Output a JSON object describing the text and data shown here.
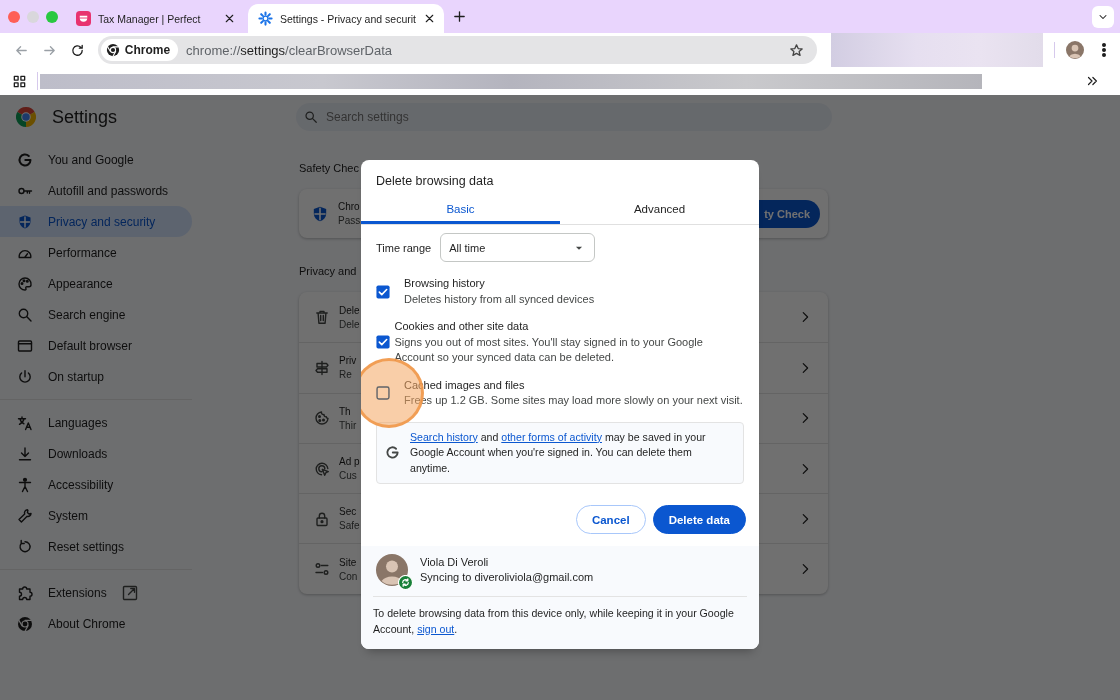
{
  "browser": {
    "tabs": [
      {
        "title": "Tax Manager | Perfect",
        "selected": false
      },
      {
        "title": "Settings - Privacy and securit",
        "selected": true
      }
    ],
    "site_chip": "Chrome",
    "url": "chrome://**settings**/clearBrowserData"
  },
  "settings": {
    "title": "Settings",
    "search": {
      "placeholder": "Search settings"
    },
    "sidebar_groups": [
      {
        "items": [
          {
            "label": "You and Google",
            "selected": false
          },
          {
            "label": "Autofill and passwords",
            "selected": false
          },
          {
            "label": "Privacy and security",
            "selected": true
          },
          {
            "label": "Performance",
            "selected": false
          },
          {
            "label": "Appearance",
            "selected": false
          },
          {
            "label": "Search engine",
            "selected": false
          },
          {
            "label": "Default browser",
            "selected": false
          },
          {
            "label": "On startup",
            "selected": false
          }
        ]
      },
      {
        "items": [
          {
            "label": "Languages",
            "selected": false
          },
          {
            "label": "Downloads",
            "selected": false
          },
          {
            "label": "Accessibility",
            "selected": false
          },
          {
            "label": "System",
            "selected": false
          },
          {
            "label": "Reset settings",
            "selected": false
          }
        ]
      },
      {
        "items": [
          {
            "label": "Extensions",
            "selected": false
          },
          {
            "label": "About Chrome",
            "selected": false
          }
        ]
      }
    ],
    "safety_check": {
      "heading": "Safety Chec",
      "card_title": "Chro",
      "card_subtitle": "Pass",
      "button": "ty Check"
    },
    "privacy": {
      "heading": "Privacy and",
      "rows": [
        {
          "title": "Dele",
          "subtitle": "Dele"
        },
        {
          "title": "Priv",
          "subtitle": "Re"
        },
        {
          "title": "Th",
          "subtitle": "Thir"
        },
        {
          "title": "Ad p",
          "subtitle": "Cus"
        },
        {
          "title": "Sec",
          "subtitle": "Safe"
        },
        {
          "title": "Site",
          "subtitle": "Con"
        }
      ]
    }
  },
  "dialog": {
    "title": "Delete browsing data",
    "tabs": [
      {
        "label": "Basic",
        "selected": true
      },
      {
        "label": "Advanced",
        "selected": false
      }
    ],
    "time_range": {
      "label": "Time range",
      "value": "All time"
    },
    "options": [
      {
        "title": "Browsing history",
        "description": "Deletes history from all synced devices",
        "checked": true,
        "highlighted": false
      },
      {
        "title": "Cookies and other site data",
        "description": "Signs you out of most sites. You'll stay signed in to your Google Account so your synced data can be deleted.",
        "checked": true,
        "highlighted": false
      },
      {
        "title": "Cached images and files",
        "description": "Frees up 1.2 GB. Some sites may load more slowly on your next visit.",
        "checked": false,
        "highlighted": true
      }
    ],
    "notice": {
      "parts": [
        {
          "kind": "link",
          "text": "Search history"
        },
        {
          "kind": "text",
          "text": " and "
        },
        {
          "kind": "link",
          "text": "other forms of activity"
        },
        {
          "kind": "text",
          "text": " may be saved in your Google Account when you're signed in. You can delete them anytime."
        }
      ]
    },
    "buttons": [
      {
        "label": "Cancel",
        "kind": "secondary"
      },
      {
        "label": "Delete data",
        "kind": "primary"
      }
    ],
    "account": {
      "name": "Viola Di Veroli",
      "status": "Syncing to diveroliviola@gmail.com"
    },
    "footer": {
      "parts": [
        {
          "kind": "text",
          "text": "To delete browsing data from this device only, while keeping it in your Google Account, "
        },
        {
          "kind": "link",
          "text": "sign out"
        },
        {
          "kind": "text",
          "text": "."
        }
      ]
    }
  }
}
